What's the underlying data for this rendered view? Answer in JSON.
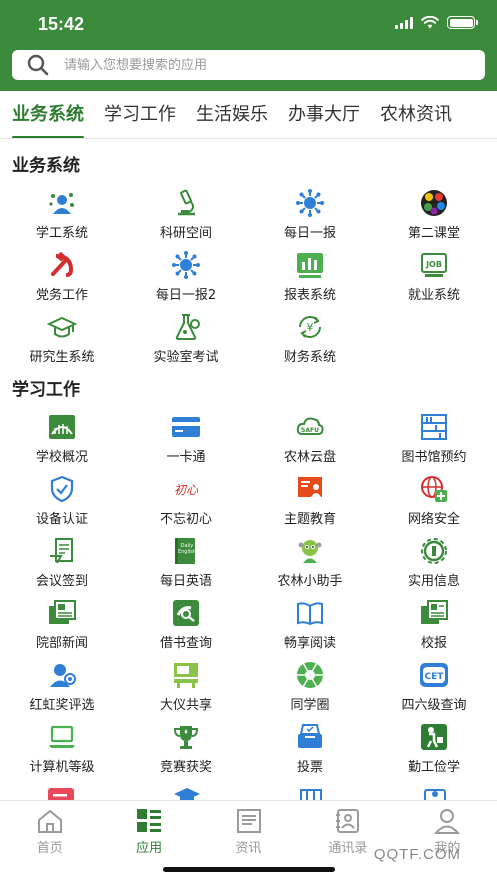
{
  "status": {
    "time": "15:42"
  },
  "search": {
    "placeholder": "请输入您想要搜索的应用"
  },
  "tabs": [
    {
      "label": "业务系统",
      "active": true
    },
    {
      "label": "学习工作",
      "active": false
    },
    {
      "label": "生活娱乐",
      "active": false
    },
    {
      "label": "办事大厅",
      "active": false
    },
    {
      "label": "农林资讯",
      "active": false
    }
  ],
  "sections": [
    {
      "title": "业务系统",
      "apps": [
        {
          "label": "学工系统",
          "icon": "student-work-icon"
        },
        {
          "label": "科研空间",
          "icon": "microscope-icon"
        },
        {
          "label": "每日一报",
          "icon": "virus-icon"
        },
        {
          "label": "第二课堂",
          "icon": "palette-icon"
        },
        {
          "label": "党务工作",
          "icon": "party-emblem-icon"
        },
        {
          "label": "每日一报2",
          "icon": "virus-icon"
        },
        {
          "label": "报表系统",
          "icon": "report-chart-icon"
        },
        {
          "label": "就业系统",
          "icon": "job-icon"
        },
        {
          "label": "研究生系统",
          "icon": "graduation-cap-icon"
        },
        {
          "label": "实验室考试",
          "icon": "flask-icon"
        },
        {
          "label": "财务系统",
          "icon": "yuan-cycle-icon"
        }
      ]
    },
    {
      "title": "学习工作",
      "apps": [
        {
          "label": "学校概况",
          "icon": "school-icon"
        },
        {
          "label": "一卡通",
          "icon": "card-icon"
        },
        {
          "label": "农林云盘",
          "icon": "cloud-disk-icon"
        },
        {
          "label": "图书馆预约",
          "icon": "library-icon"
        },
        {
          "label": "设备认证",
          "icon": "shield-check-icon"
        },
        {
          "label": "不忘初心",
          "icon": "calligraphy-icon"
        },
        {
          "label": "主题教育",
          "icon": "teacher-board-icon"
        },
        {
          "label": "网络安全",
          "icon": "globe-plus-icon"
        },
        {
          "label": "会议签到",
          "icon": "sign-in-icon"
        },
        {
          "label": "每日英语",
          "icon": "english-book-icon"
        },
        {
          "label": "农林小助手",
          "icon": "assistant-mascot-icon"
        },
        {
          "label": "实用信息",
          "icon": "info-gear-icon"
        },
        {
          "label": "院部新闻",
          "icon": "news-icon"
        },
        {
          "label": "借书查询",
          "icon": "book-search-icon"
        },
        {
          "label": "畅享阅读",
          "icon": "open-book-icon"
        },
        {
          "label": "校报",
          "icon": "newspaper-icon"
        },
        {
          "label": "红虹奖评选",
          "icon": "user-award-icon"
        },
        {
          "label": "大仪共享",
          "icon": "instrument-share-icon"
        },
        {
          "label": "同学圈",
          "icon": "aperture-icon"
        },
        {
          "label": "四六级查询",
          "icon": "cet-icon"
        },
        {
          "label": "计算机等级",
          "icon": "laptop-icon"
        },
        {
          "label": "竞赛获奖",
          "icon": "trophy-icon"
        },
        {
          "label": "投票",
          "icon": "ballot-box-icon"
        },
        {
          "label": "勤工俭学",
          "icon": "worker-icon"
        }
      ]
    }
  ],
  "bottom_tabs": [
    {
      "label": "首页",
      "icon": "home-icon",
      "active": false
    },
    {
      "label": "应用",
      "icon": "apps-grid-icon",
      "active": true
    },
    {
      "label": "资讯",
      "icon": "news-doc-icon",
      "active": false
    },
    {
      "label": "通讯录",
      "icon": "contacts-icon",
      "active": false
    },
    {
      "label": "我的",
      "icon": "profile-icon",
      "active": false
    }
  ],
  "watermark": "QQTF.COM",
  "colors": {
    "brand_green": "#3c8a3c",
    "active_green": "#2f7d32",
    "blue": "#2f7fd6",
    "red": "#d32f2f"
  }
}
